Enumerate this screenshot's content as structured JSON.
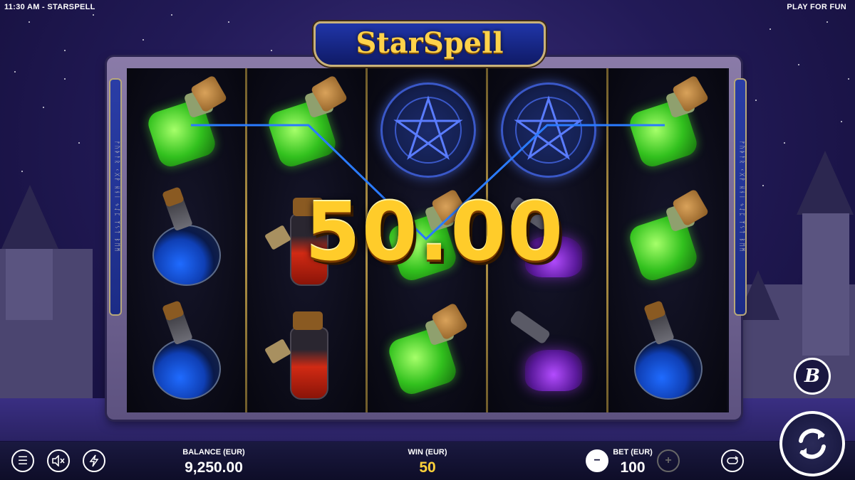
{
  "header": {
    "time_app": "11:30 AM - STARSPELL",
    "mode": "PLAY FOR FUN"
  },
  "logo": {
    "text": "StarSpell"
  },
  "win_display": {
    "amount": "50.00"
  },
  "reels": [
    [
      "green-potion",
      "blue-flask",
      "blue-flask"
    ],
    [
      "green-potion",
      "red-vial",
      "red-vial"
    ],
    [
      "pentagram",
      "green-potion",
      "green-potion"
    ],
    [
      "pentagram",
      "purple-vial",
      "purple-vial"
    ],
    [
      "green-potion",
      "green-potion",
      "blue-flask"
    ]
  ],
  "bottom_bar": {
    "balance_label": "BALANCE (EUR)",
    "balance_value": "9,250.00",
    "win_label": "WIN (EUR)",
    "win_value": "50",
    "bet_label": "BET (EUR)",
    "bet_value": "100",
    "minus_symbol": "−",
    "plus_symbol": "+"
  },
  "icons": {
    "menu": "menu-icon",
    "sound": "sound-muted-icon",
    "turbo": "lightning-icon",
    "autoplay": "autoplay-icon",
    "spin": "spin-icon",
    "brand": "B"
  },
  "colors": {
    "win_gold": "#ffcc2a",
    "payline": "#2a7bff",
    "win_value": "#ffd23a"
  }
}
